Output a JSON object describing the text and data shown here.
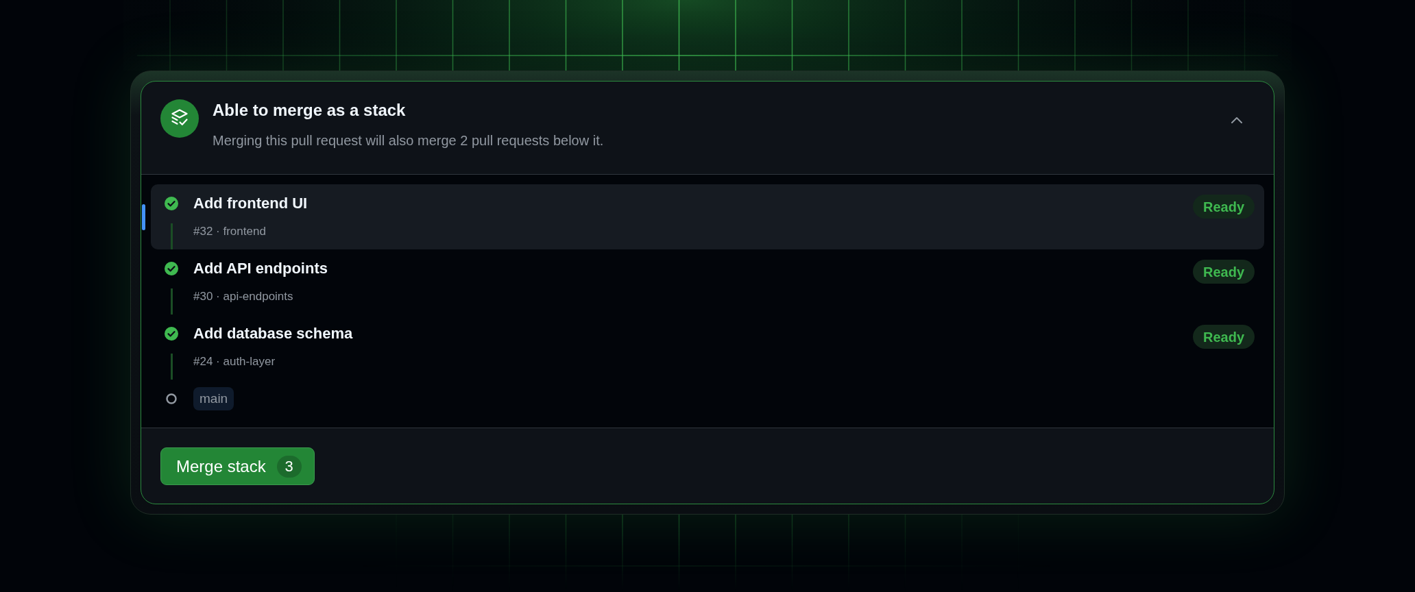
{
  "header": {
    "title": "Able to merge as a stack",
    "subtitle": "Merging this pull request will also merge 2 pull requests below it.",
    "expanded": true
  },
  "pull_requests": [
    {
      "title": "Add frontend UI",
      "meta": "#32 · frontend",
      "status": "Ready",
      "passing": true,
      "selected": true
    },
    {
      "title": "Add API endpoints",
      "meta": "#30 · api-endpoints",
      "status": "Ready",
      "passing": true,
      "selected": false
    },
    {
      "title": "Add database schema",
      "meta": "#24 · auth-layer",
      "status": "Ready",
      "passing": true,
      "selected": false
    }
  ],
  "base_branch": {
    "name": "main"
  },
  "merge_button": {
    "label": "Merge stack",
    "count": "3"
  }
}
